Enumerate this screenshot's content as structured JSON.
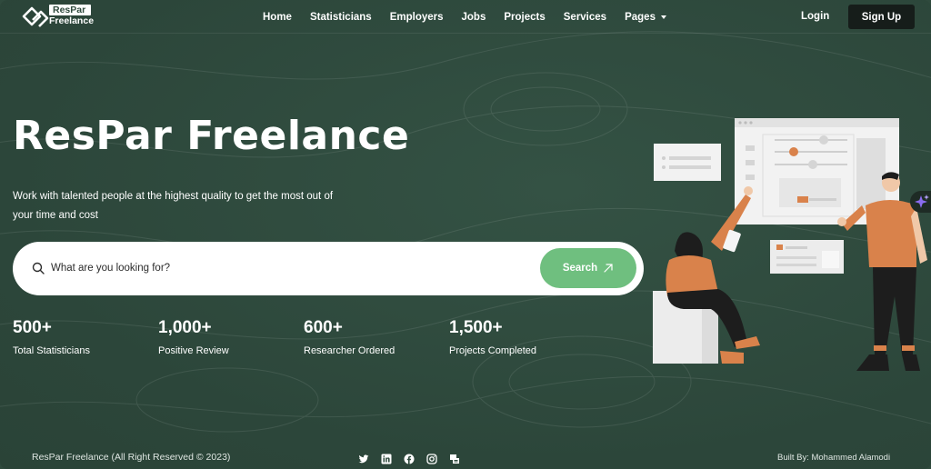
{
  "nav": {
    "logo_top": "ResPar",
    "logo_bottom": "Freelance",
    "items": [
      {
        "label": "Home"
      },
      {
        "label": "Statisticians"
      },
      {
        "label": "Employers"
      },
      {
        "label": "Jobs"
      },
      {
        "label": "Projects"
      },
      {
        "label": "Services"
      },
      {
        "label": "Pages"
      }
    ],
    "login": "Login",
    "signup": "Sign Up"
  },
  "hero": {
    "title": "ResPar Freelance",
    "subtitle": "Work with talented people at the highest quality to get the most out of your time and cost"
  },
  "search": {
    "placeholder": "What are you looking for?",
    "value": "",
    "button": "Search"
  },
  "stats": [
    {
      "value": "500+",
      "label": "Total Statisticians"
    },
    {
      "value": "1,000+",
      "label": "Positive Review"
    },
    {
      "value": "600+",
      "label": "Researcher Ordered"
    },
    {
      "value": "1,500+",
      "label": "Projects Completed"
    }
  ],
  "footer": {
    "copyright": "ResPar Freelance (All Right Reserved © 2023)",
    "built_by": "Built By: Mohammed Alamodi",
    "social_icons": [
      "twitter-icon",
      "linkedin-icon",
      "facebook-icon",
      "instagram-icon",
      "blog-icon"
    ]
  },
  "colors": {
    "background": "#2f4a3d",
    "accent_green": "#6fbf7f",
    "signup_bg": "#161d1a",
    "illustration_orange": "#d9824b"
  }
}
